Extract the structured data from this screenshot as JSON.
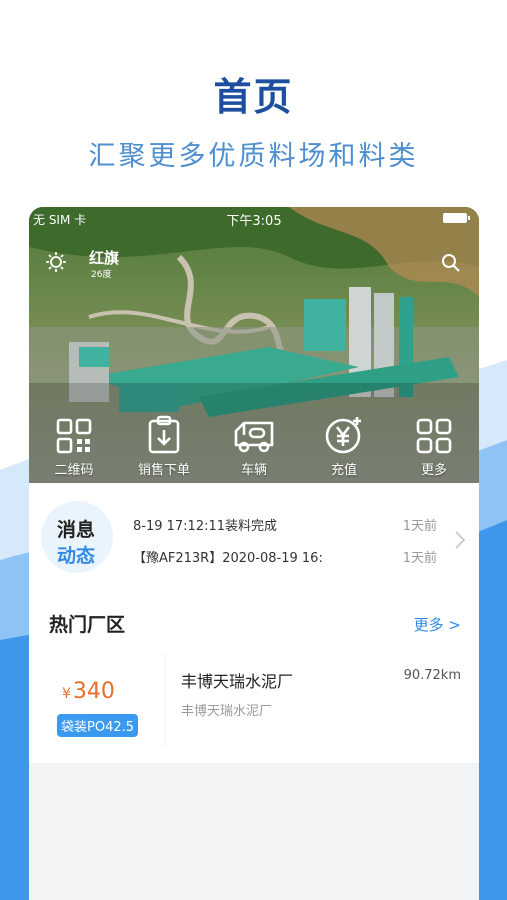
{
  "promo": {
    "title": "首页",
    "subtitle": "汇聚更多优质料场和料类"
  },
  "status_bar": {
    "carrier": "无 SIM 卡",
    "time": "下午3:05"
  },
  "header": {
    "location": "红旗",
    "temperature": "26度"
  },
  "quick_actions": [
    {
      "label": "二维码",
      "icon": "qr-code-icon"
    },
    {
      "label": "销售下单",
      "icon": "clipboard-download-icon"
    },
    {
      "label": "车辆",
      "icon": "truck-icon"
    },
    {
      "label": "充值",
      "icon": "yuan-coin-icon"
    },
    {
      "label": "更多",
      "icon": "grid-icon"
    }
  ],
  "messages": {
    "badge_line1": "消息",
    "badge_line2": "动态",
    "items": [
      {
        "text": "8-19 17:12:11装料完成",
        "time": "1天前"
      },
      {
        "text": "【豫AF213R】2020-08-19 16:",
        "time": "1天前"
      }
    ]
  },
  "hot_plants": {
    "title": "热门厂区",
    "more": "更多 >",
    "items": [
      {
        "currency": "¥",
        "price": "340",
        "product_tag": "袋装PO42.5",
        "name": "丰博天瑞水泥厂",
        "subtitle": "丰博天瑞水泥厂",
        "distance": "90.72km"
      }
    ]
  },
  "colors": {
    "brand_blue": "#2f8be6",
    "title_blue": "#1d4f9e",
    "price_orange": "#e8702c",
    "tag_blue": "#3a9af0"
  }
}
